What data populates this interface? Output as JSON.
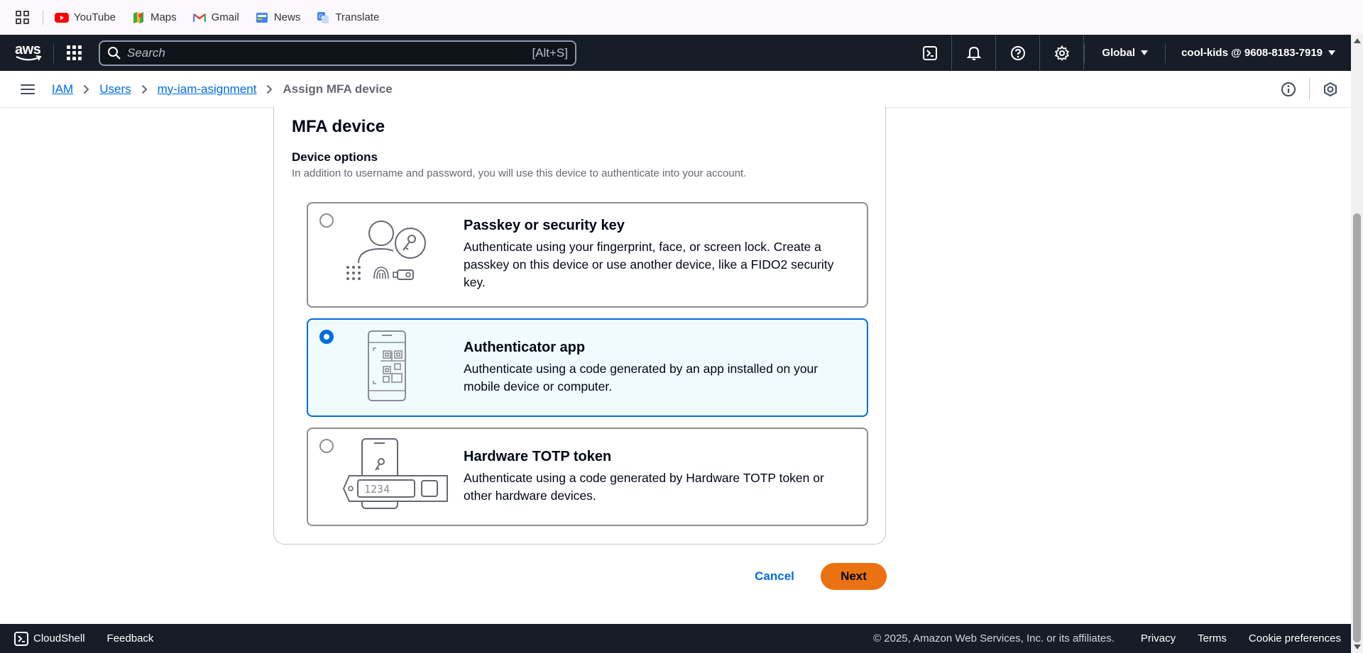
{
  "bookmarks": [
    {
      "label": "YouTube",
      "icon": "youtube-icon"
    },
    {
      "label": "Maps",
      "icon": "maps-icon"
    },
    {
      "label": "Gmail",
      "icon": "gmail-icon"
    },
    {
      "label": "News",
      "icon": "news-icon"
    },
    {
      "label": "Translate",
      "icon": "translate-icon"
    }
  ],
  "topnav": {
    "logo": "aws",
    "search_placeholder": "Search",
    "search_shortcut": "[Alt+S]",
    "region": "Global",
    "account": "cool-kids @ 9608-8183-7919",
    "icons": [
      "cloudshell-icon",
      "bell-icon",
      "help-icon",
      "gear-icon"
    ]
  },
  "breadcrumb": {
    "items": [
      "IAM",
      "Users",
      "my-iam-asignment"
    ],
    "current": "Assign MFA device"
  },
  "panel": {
    "title": "MFA device",
    "options_label": "Device options",
    "options_description": "In addition to username and password, you will use this device to authenticate into your account.",
    "options": [
      {
        "title": "Passkey or security key",
        "text": "Authenticate using your fingerprint, face, or screen lock. Create a passkey on this device or use another device, like a FIDO2 security key.",
        "selected": false
      },
      {
        "title": "Authenticator app",
        "text": "Authenticate using a code generated by an app installed on your mobile device or computer.",
        "selected": true
      },
      {
        "title": "Hardware TOTP token",
        "text": "Authenticate using a code generated by Hardware TOTP token or other hardware devices.",
        "selected": false,
        "illustration_code": "1234"
      }
    ]
  },
  "actions": {
    "cancel": "Cancel",
    "next": "Next"
  },
  "footer": {
    "cloudshell": "CloudShell",
    "feedback": "Feedback",
    "copyright": "© 2025, Amazon Web Services, Inc. or its affiliates.",
    "privacy": "Privacy",
    "terms": "Terms",
    "cookies": "Cookie preferences"
  },
  "colors": {
    "nav_bg": "#161d26",
    "link": "#006ce0",
    "primary_button": "#ec7211",
    "selected_bg": "#f0fbff"
  }
}
